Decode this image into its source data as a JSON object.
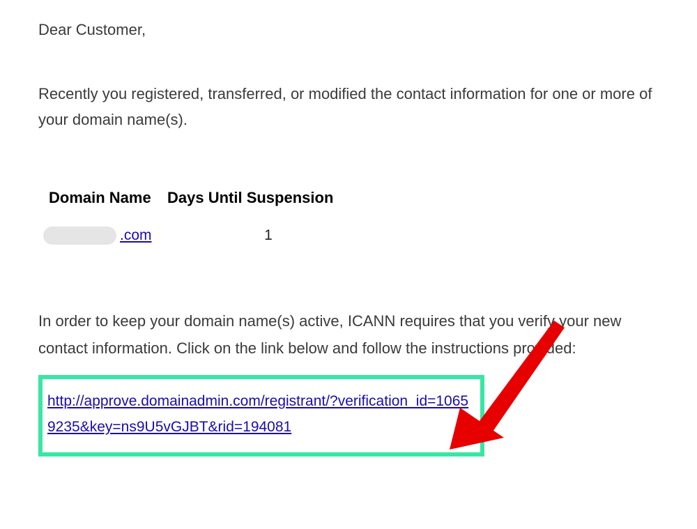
{
  "email": {
    "greeting": "Dear Customer,",
    "intro_paragraph": "Recently you registered, transferred, or modified the contact information for one or more of your domain name(s).",
    "table": {
      "headers": {
        "domain": "Domain Name",
        "days": "Days Until Suspension"
      },
      "row": {
        "domain_suffix": ".com",
        "days_until_suspension": "1"
      }
    },
    "instruction_paragraph": "In order to keep your domain name(s) active, ICANN requires that you verify your new contact information. Click on the link below and follow the instructions provided:",
    "verification_link": "http://approve.domainadmin.com/registrant/?verification_id=10659235&key=ns9U5vGJBT&rid=194081"
  },
  "annotation": {
    "highlight_color": "#39e6a5",
    "arrow_color": "#e60000"
  }
}
